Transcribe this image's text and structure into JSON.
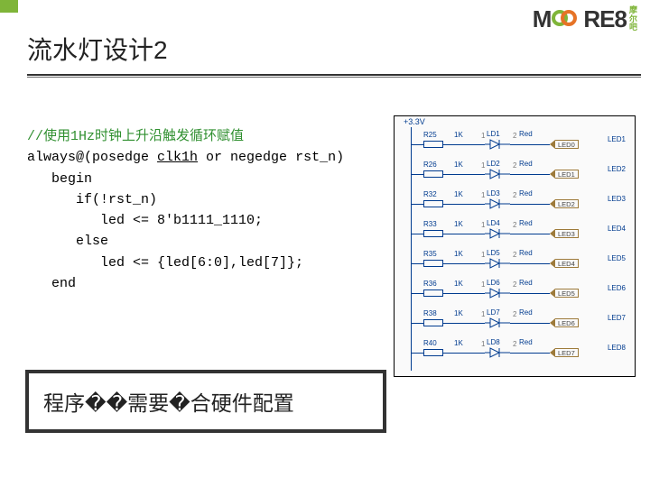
{
  "logo": {
    "m": "M",
    "re8": "RE8",
    "cn1": "摩",
    "cn2": "尔",
    "cn3": "吧"
  },
  "title": "流水灯设计2",
  "code": {
    "comment": "//使用1Hz时钟上升沿触发循环赋值",
    "l1a": "always@(posedge ",
    "l1b": "clk1h",
    "l1c": " or negedge rst_n)",
    "l2": "   begin",
    "l3": "      if(!rst_n)",
    "l4": "         led <= 8'b1111_1110;",
    "l5": "      else",
    "l6": "         led <= {led[6:0],led[7]};",
    "l7": "   end"
  },
  "callout": "程序��需要�合硬件配置",
  "schematic": {
    "vcc": "+3.3V",
    "rows": [
      {
        "r": "R25",
        "rv": "1K",
        "ld": "LD1",
        "net": "LED0",
        "led": "LED1"
      },
      {
        "r": "R26",
        "rv": "1K",
        "ld": "LD2",
        "net": "LED1",
        "led": "LED2"
      },
      {
        "r": "R32",
        "rv": "1K",
        "ld": "LD3",
        "net": "LED2",
        "led": "LED3"
      },
      {
        "r": "R33",
        "rv": "1K",
        "ld": "LD4",
        "net": "LED3",
        "led": "LED4"
      },
      {
        "r": "R35",
        "rv": "1K",
        "ld": "LD5",
        "net": "LED4",
        "led": "LED5"
      },
      {
        "r": "R36",
        "rv": "1K",
        "ld": "LD6",
        "net": "LED5",
        "led": "LED6"
      },
      {
        "r": "R38",
        "rv": "1K",
        "ld": "LD7",
        "net": "LED6",
        "led": "LED7"
      },
      {
        "r": "R40",
        "rv": "1K",
        "ld": "LD8",
        "net": "LED7",
        "led": "LED8"
      }
    ],
    "num1": "1",
    "num2": "2",
    "red": "Red"
  }
}
